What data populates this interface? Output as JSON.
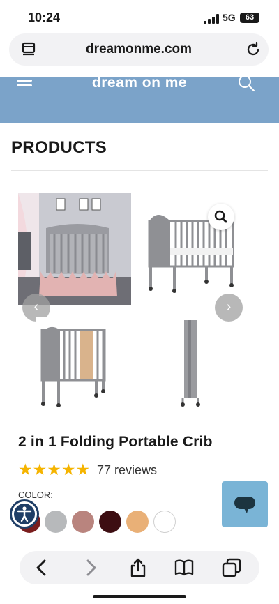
{
  "status_bar": {
    "time": "10:24",
    "network": "5G",
    "battery": "63"
  },
  "browser": {
    "url": "dreamonme.com"
  },
  "site": {
    "logo": "dream on me",
    "brand_color": "#7ba3c9"
  },
  "page": {
    "section_title": "PRODUCTS"
  },
  "product": {
    "title": "2 in 1 Folding Portable Crib",
    "rating_stars": "★★★★★",
    "rating": 5,
    "reviews": "77 reviews",
    "color_label": "COLOR:",
    "swatches": [
      "#7a1d1d",
      "#b7b9bb",
      "#b9847e",
      "#3d0e12",
      "#e9b077",
      "#ffffff"
    ]
  },
  "gallery": {
    "prev_symbol": "‹",
    "next_symbol": "›"
  },
  "icons": [
    "tabs-icon",
    "reload-icon",
    "menu-icon",
    "search-icon",
    "zoom-icon",
    "accessibility-icon",
    "chat-icon",
    "back-icon",
    "forward-icon",
    "share-icon",
    "bookmarks-icon",
    "tabs-overview-icon"
  ]
}
